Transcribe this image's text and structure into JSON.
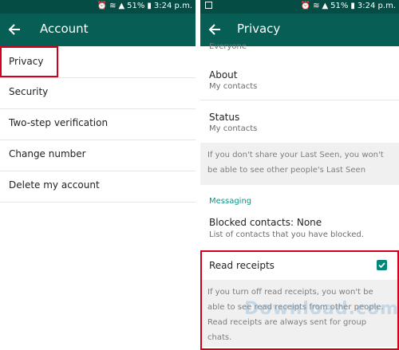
{
  "status": {
    "battery": "51%",
    "time": "3:24 p.m."
  },
  "left": {
    "title": "Account",
    "items": [
      {
        "label": "Privacy"
      },
      {
        "label": "Security"
      },
      {
        "label": "Two-step verification"
      },
      {
        "label": "Change number"
      },
      {
        "label": "Delete my account"
      }
    ]
  },
  "right": {
    "title": "Privacy",
    "clipped_text": "Everyone",
    "about": {
      "label": "About",
      "value": "My contacts"
    },
    "status_item": {
      "label": "Status",
      "value": "My contacts"
    },
    "last_seen_note": "If you don't share your Last Seen, you won't be able to see other people's Last Seen",
    "messaging_header": "Messaging",
    "blocked": {
      "label": "Blocked contacts: None",
      "sub": "List of contacts that you have blocked."
    },
    "read_receipts": {
      "label": "Read receipts",
      "checked": true
    },
    "read_receipts_note": "If you turn off read receipts, you won't be able to see read receipts from other people. Read receipts are always sent for group chats."
  },
  "watermark": "Download.com.vn",
  "colors": {
    "statusbar": "#054c44",
    "toolbar": "#075e54",
    "highlight": "#d0021b",
    "accent": "#009688"
  }
}
